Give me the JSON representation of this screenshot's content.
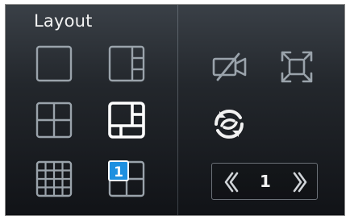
{
  "panel": {
    "title": "Layout"
  },
  "layouts": [
    {
      "name": "single",
      "selected": false
    },
    {
      "name": "one-plus-three",
      "selected": false
    },
    {
      "name": "quad",
      "selected": false
    },
    {
      "name": "one-plus-five",
      "selected": true
    },
    {
      "name": "grid-16",
      "selected": false
    },
    {
      "name": "picture-in-picture",
      "selected": false,
      "badge": "1"
    }
  ],
  "tools": {
    "camera_off": {
      "icon": "camera-off-icon"
    },
    "fullscreen": {
      "icon": "fullscreen-icon"
    },
    "refresh": {
      "icon": "refresh-icon"
    }
  },
  "pager": {
    "prev_label": "《",
    "page": "1",
    "next_label": "》"
  },
  "colors": {
    "icon_stroke": "#9aa3ab",
    "icon_selected": "#ffffff",
    "badge_fill": "#1e90e0",
    "text": "#f2f2f2"
  }
}
